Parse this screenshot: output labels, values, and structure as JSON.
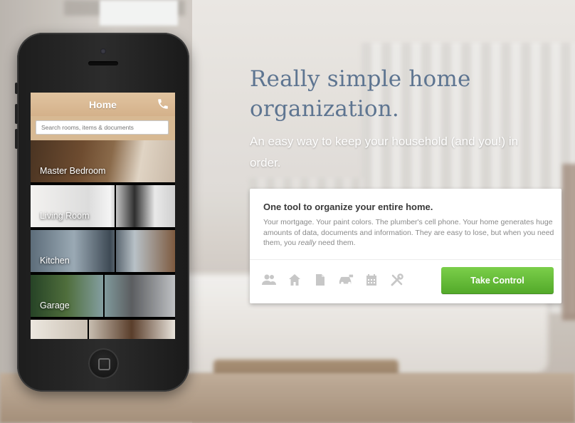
{
  "phone": {
    "app_title": "Home",
    "search": {
      "placeholder": "Search rooms, items & documents"
    },
    "rooms": [
      {
        "label": "Master Bedroom"
      },
      {
        "label": "Living Room"
      },
      {
        "label": "Kitchen"
      },
      {
        "label": "Garage"
      }
    ],
    "icons": {
      "call": "phone-icon",
      "home_button": "home-button"
    }
  },
  "hero": {
    "headline": "Really simple home organization.",
    "subhead": "An easy way to keep your household (and you!) in order."
  },
  "card": {
    "title": "One tool to organize your entire home.",
    "body_before": "Your mortgage. Your paint colors. The plumber's cell phone. Your home generates huge amounts of data, documents and information. They are easy to lose, but when you need them, you ",
    "body_emphasis": "really",
    "body_after": " need them.",
    "feature_icons": [
      "people-icon",
      "house-icon",
      "document-icon",
      "car-icon",
      "calendar-icon",
      "tools-icon"
    ],
    "cta_label": "Take Control"
  },
  "colors": {
    "headline": "#5e7591",
    "cta_green": "#5cb531",
    "app_header": "#d9b892",
    "card_bg": "#ffffff",
    "icon_gray": "#c7c7c7"
  }
}
